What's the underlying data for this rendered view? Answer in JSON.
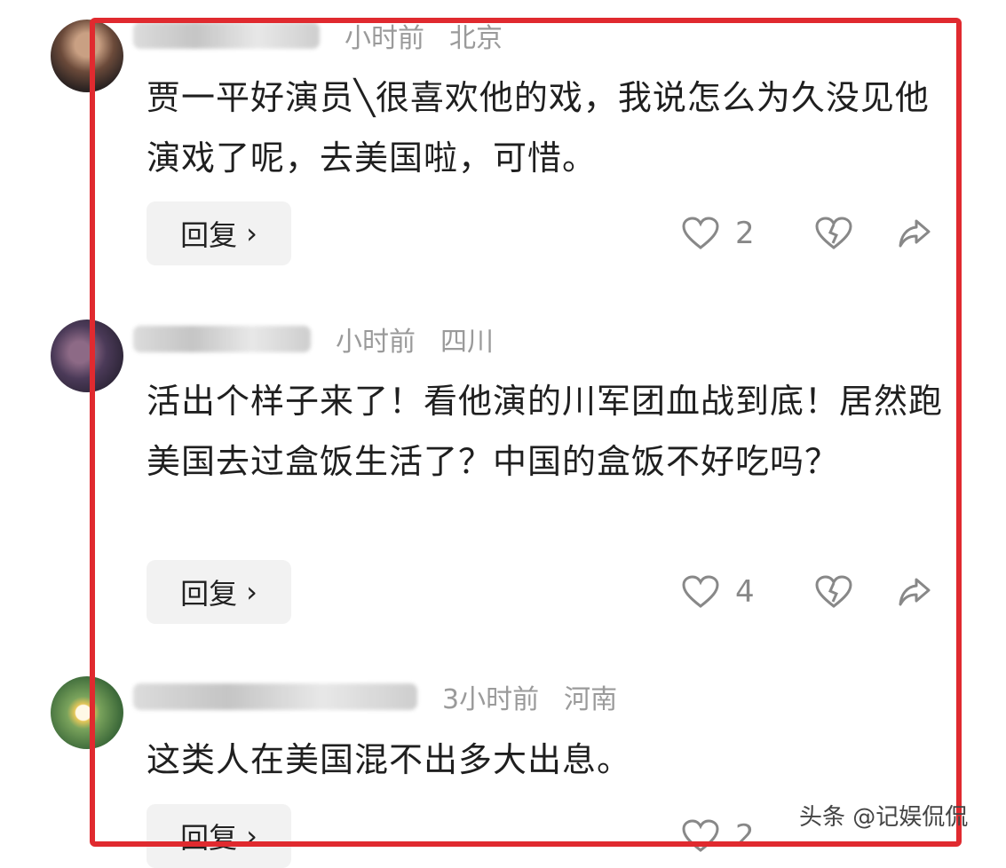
{
  "comments": [
    {
      "time": "小时前",
      "location": "北京",
      "text": "贾一平好演员╲很喜欢他的戏，我说怎么为久没见他演戏了呢，去美国啦，可惜。",
      "reply_label": "回复",
      "likes": "2"
    },
    {
      "time": "小时前",
      "location": "四川",
      "text": "活出个样子来了！看他演的川军团血战到底！居然跑美国去过盒饭生活了？中国的盒饭不好吃吗？",
      "reply_label": "回复",
      "likes": "4"
    },
    {
      "time": "3小时前",
      "location": "河南",
      "text": "这类人在美国混不出多大出息。",
      "reply_label": "回复",
      "likes": "2"
    }
  ],
  "watermark": "头条 @记娱侃侃",
  "colors": {
    "highlight_frame": "#e02a2f",
    "reply_bg": "#f2f2f2",
    "meta_text": "#9a9a9a"
  },
  "icons": [
    "heart-icon",
    "broken-heart-icon",
    "share-icon",
    "chevron-right-icon"
  ]
}
